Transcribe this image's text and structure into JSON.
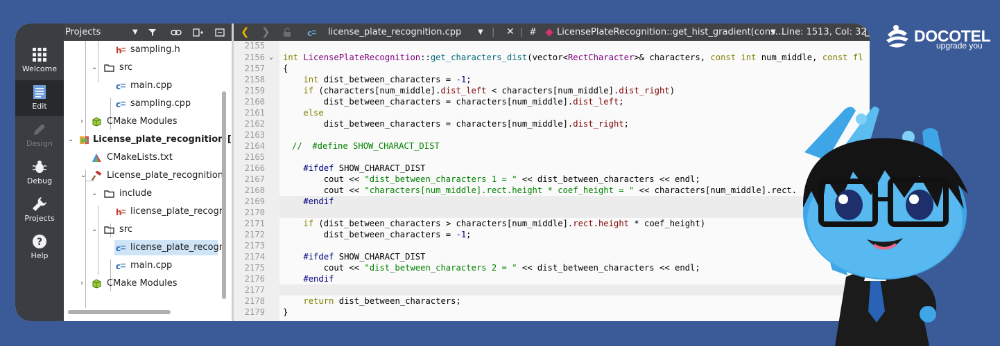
{
  "modes": [
    {
      "label": "Welcome",
      "icon": "grid-icon",
      "state": "normal"
    },
    {
      "label": "Edit",
      "icon": "document-icon",
      "state": "active"
    },
    {
      "label": "Design",
      "icon": "pen-icon",
      "state": "disabled"
    },
    {
      "label": "Debug",
      "icon": "bug-icon",
      "state": "normal"
    },
    {
      "label": "Projects",
      "icon": "wrench-icon",
      "state": "normal"
    },
    {
      "label": "Help",
      "icon": "help-icon",
      "state": "normal"
    }
  ],
  "projects_pane": {
    "view_selector": "Projects",
    "tree": [
      {
        "label": "sampling.h",
        "icon": "header-file-icon"
      },
      {
        "label": "src",
        "icon": "folder-icon"
      },
      {
        "label": "main.cpp",
        "icon": "cpp-file-icon"
      },
      {
        "label": "sampling.cpp",
        "icon": "cpp-file-icon"
      },
      {
        "label": "CMake Modules",
        "icon": "cmake-modules-icon"
      },
      {
        "label": "License_plate_recognition [m",
        "icon": "project-icon"
      },
      {
        "label": "CMakeLists.txt",
        "icon": "cmake-file-icon"
      },
      {
        "label": "License_plate_recognition",
        "icon": "hammer-icon"
      },
      {
        "label": "include",
        "icon": "folder-icon"
      },
      {
        "label": "license_plate_recogr",
        "icon": "header-file-icon"
      },
      {
        "label": "src",
        "icon": "folder-icon"
      },
      {
        "label": "license_plate_recogn",
        "icon": "cpp-file-icon"
      },
      {
        "label": "main.cpp",
        "icon": "cpp-file-icon"
      },
      {
        "label": "CMake Modules",
        "icon": "cmake-modules-icon"
      }
    ]
  },
  "editor_toolbar": {
    "file_name": "license_plate_recognition.cpp",
    "hash": "#",
    "symbol": "LicensePlateRecognition::get_hist_gradient(cons...",
    "position": "Line: 1513, Col: 32"
  },
  "editor": {
    "lines": [
      {
        "n": "2155"
      },
      {
        "n": "2156"
      },
      {
        "n": "2157"
      },
      {
        "n": "2158"
      },
      {
        "n": "2159"
      },
      {
        "n": "2160"
      },
      {
        "n": "2161"
      },
      {
        "n": "2162"
      },
      {
        "n": "2163"
      },
      {
        "n": "2164"
      },
      {
        "n": "2165"
      },
      {
        "n": "2166"
      },
      {
        "n": "2167"
      },
      {
        "n": "2168"
      },
      {
        "n": "2169"
      },
      {
        "n": "2170"
      },
      {
        "n": "2171"
      },
      {
        "n": "2172"
      },
      {
        "n": "2173"
      },
      {
        "n": "2174"
      },
      {
        "n": "2175"
      },
      {
        "n": "2176"
      },
      {
        "n": "2177"
      },
      {
        "n": "2178"
      },
      {
        "n": "2179"
      }
    ],
    "code": {
      "l2156_1": "int",
      "l2156_2": "LicensePlateRecognition",
      "l2156_3": "::",
      "l2156_4": "get_characters_dist",
      "l2156_5": "(vector<",
      "l2156_6": "RectCharacter",
      "l2156_7": ">& characters, ",
      "l2156_8": "const int",
      "l2156_9": " num_middle, ",
      "l2156_10": "const fl",
      "l2157": "{",
      "l2158_1": "int",
      "l2158_2": " dist_between_characters = ",
      "l2158_3": "-1",
      "l2158_4": ";",
      "l2159_1": "if",
      "l2159_2": " (characters[num_middle].",
      "l2159_3": "dist_left",
      "l2159_4": " < characters[num_middle].",
      "l2159_5": "dist_right",
      "l2159_6": ")",
      "l2160_1": "dist_between_characters = characters[num_middle].",
      "l2160_2": "dist_left",
      "l2160_3": ";",
      "l2161": "else",
      "l2162_1": "dist_between_characters = characters[num_middle].",
      "l2162_2": "dist_right",
      "l2162_3": ";",
      "l2164": "//  #define SHOW_CHARACT_DIST",
      "l2166_1": "#ifdef",
      "l2166_2": " SHOW_CHARACT_DIST",
      "l2167_1": "cout << ",
      "l2167_2": "\"dist_between_characters 1 = \"",
      "l2167_3": " << dist_between_characters << endl;",
      "l2168_1": "cout << ",
      "l2168_2": "\"characters[num_middle].rect.height * coef_height = \"",
      "l2168_3": " << characters[num_middle].rect.",
      "l2169": "#endif",
      "l2171_1": "if",
      "l2171_2": " (dist_between_characters > characters[num_middle].",
      "l2171_3": "rect",
      "l2171_4": ".",
      "l2171_5": "height",
      "l2171_6": " * coef_height)",
      "l2172_1": "dist_between_characters = ",
      "l2172_2": "-1",
      "l2172_3": ";",
      "l2174_1": "#ifdef",
      "l2174_2": " SHOW_CHARACT_DIST",
      "l2175_1": "cout << ",
      "l2175_2": "\"dist_between_characters 2 = \"",
      "l2175_3": " << dist_between_characters << endl;",
      "l2176": "#endif",
      "l2178_1": "return",
      "l2178_2": " dist_between_characters;",
      "l2179": "}"
    }
  },
  "brand": {
    "name": "DOCOTEL",
    "slogan": "upgrade you"
  },
  "colors": {
    "background": "#3b5b98",
    "toolbar": "#404244",
    "modebar": "#3a3d41",
    "selection": "#cfe4f7",
    "accent_chevron": "#e8b100",
    "mascot_skin": "#3ea6e6"
  }
}
